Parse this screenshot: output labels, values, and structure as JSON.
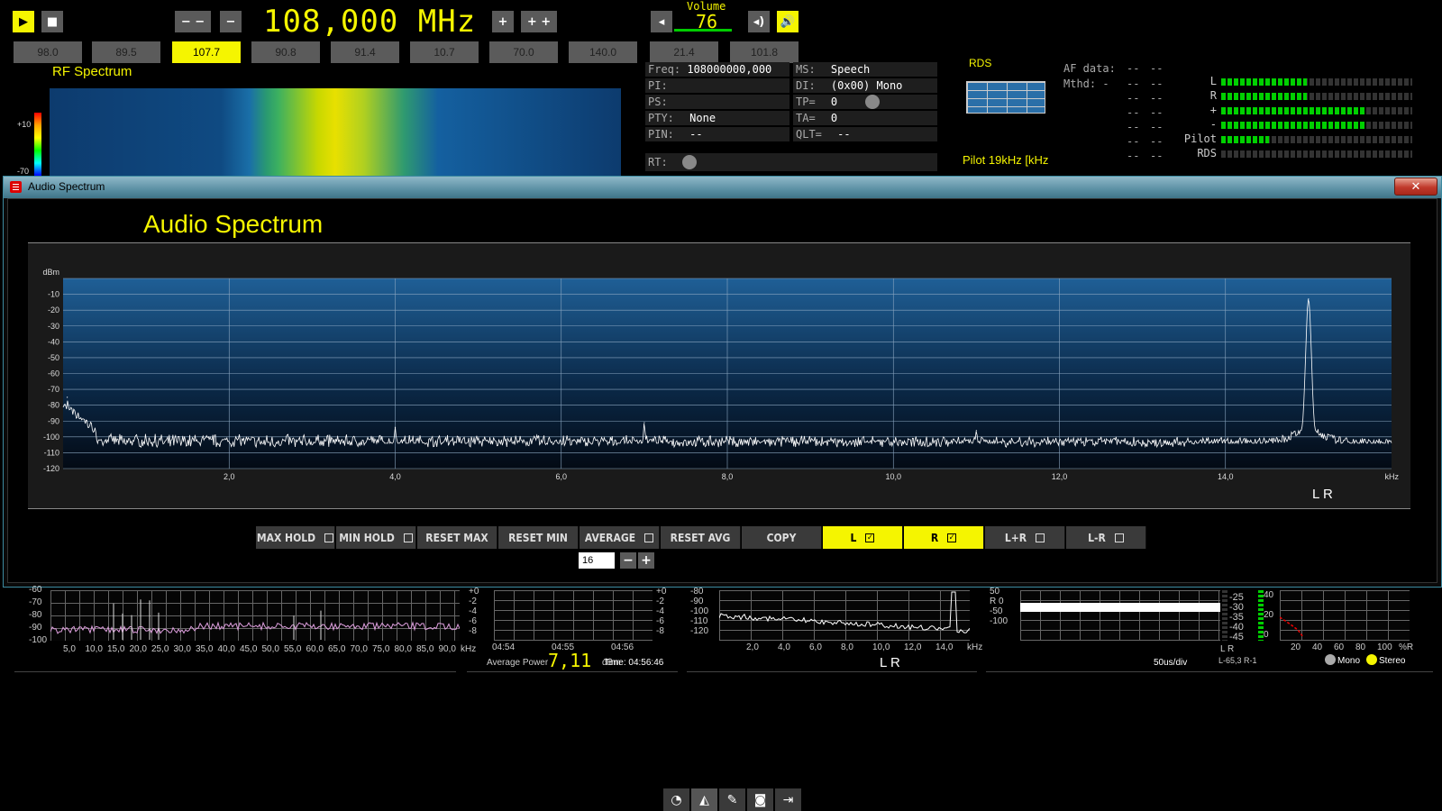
{
  "toolbar": {
    "play_icon": "play-icon",
    "stop_icon": "stop-icon",
    "tune_down_fast": "− −",
    "tune_down": "−",
    "frequency": "108,000 MHz",
    "tune_up": "+",
    "tune_up_fast": "+ +",
    "volume_label": "Volume",
    "volume_value": "76",
    "speaker_icon": "speaker-icon"
  },
  "presets": [
    "98.0",
    "89.5",
    "107.7",
    "90.8",
    "91.4",
    "10.7",
    "70.0",
    "140.0",
    "21.4",
    "101.8"
  ],
  "active_preset": "107.7",
  "rf": {
    "title": "RF Spectrum",
    "scale_top": "+10",
    "scale_bottom": "-70"
  },
  "rds": {
    "freq_label": "Freq:",
    "freq_value": "108000000,000 Hz",
    "ms_label": "MS:",
    "ms_value": "Speech",
    "pi_label": "PI:",
    "di_label": "DI:",
    "di_value": "(0x00) Mono",
    "ps_label": "PS:",
    "tp_label": "TP=",
    "tp_value": "0",
    "pty_label": "PTY:",
    "pty_value": "None",
    "ta_label": "TA=",
    "ta_value": "0",
    "pin_label": "PIN:",
    "pin_value": "--",
    "qlt_label": "QLT=",
    "qlt_value": "--",
    "rt_label": "RT:",
    "grid_label": "RDS",
    "pilot_label": "Pilot 19kHz  [kHz"
  },
  "af": {
    "af_label": "AF data:",
    "mthd_label": "Mthd: -",
    "dash": "--"
  },
  "meters": {
    "labels": [
      "L",
      "R",
      "+",
      "-",
      "Pilot",
      "RDS"
    ],
    "levels": [
      0.45,
      0.45,
      0.75,
      0.75,
      0.25,
      0.0
    ]
  },
  "dialog": {
    "title": "Audio Spectrum",
    "close": "✕",
    "heading": "Audio Spectrum",
    "channel_label": "L R",
    "controls": [
      {
        "label": "MAX HOLD",
        "checked": false,
        "on": false
      },
      {
        "label": "MIN HOLD",
        "checked": false,
        "on": false
      },
      {
        "label": "RESET MAX",
        "checked": null,
        "on": false
      },
      {
        "label": "RESET MIN",
        "checked": null,
        "on": false
      },
      {
        "label": "AVERAGE",
        "checked": false,
        "on": false
      },
      {
        "label": "RESET AVG",
        "checked": null,
        "on": false
      },
      {
        "label": "COPY",
        "checked": null,
        "on": false
      },
      {
        "label": "L",
        "checked": true,
        "on": true
      },
      {
        "label": "R",
        "checked": true,
        "on": true
      },
      {
        "label": "L+R",
        "checked": false,
        "on": false
      },
      {
        "label": "L-R",
        "checked": false,
        "on": false
      }
    ],
    "average_count": "16",
    "minus": "−",
    "plus": "+"
  },
  "chart_data": {
    "type": "line",
    "title": "",
    "ylabel": "dBm",
    "xlabel": "kHz",
    "xlim": [
      0,
      16
    ],
    "ylim": [
      -120,
      0
    ],
    "yticks": [
      -10,
      -20,
      -30,
      -40,
      -50,
      -60,
      -70,
      -80,
      -90,
      -100,
      -110,
      -120
    ],
    "xticks": [
      "2,0",
      "4,0",
      "6,0",
      "8,0",
      "10,0",
      "12,0",
      "14,0"
    ],
    "series": [
      {
        "noise_floor": -104,
        "peaks": [
          {
            "x": 0.05,
            "y": -75
          },
          {
            "x": 4.0,
            "y": -94
          },
          {
            "x": 7.0,
            "y": -91
          },
          {
            "x": 11.0,
            "y": -96
          },
          {
            "x": 15.0,
            "y": -13
          }
        ]
      }
    ]
  },
  "bottom": {
    "p1_ticks_y": [
      "-60",
      "-70",
      "-80",
      "-90",
      "-100"
    ],
    "p1_ticks_x": [
      "5,0",
      "10,0",
      "15,0",
      "20,0",
      "25,0",
      "30,0",
      "35,0",
      "40,0",
      "45,0",
      "50,0",
      "55,0",
      "60,0",
      "65,0",
      "70,0",
      "75,0",
      "80,0",
      "85,0",
      "90,0",
      "kHz"
    ],
    "p2_ticks_left": [
      "+0",
      "-2",
      "-4",
      "-6",
      "-8"
    ],
    "p2_ticks_right": [
      "+0",
      "-2",
      "-4",
      "-6",
      "-8"
    ],
    "p2_times": [
      "04:54",
      "04:55",
      "04:56"
    ],
    "p2_avg_label": "Average Power",
    "p2_avg_value": "7,11",
    "p2_unit": "dBm",
    "p2_time_label": "Time: 04:56:46",
    "p3_ticks_y": [
      "-80",
      "-90",
      "-100",
      "-110",
      "-120"
    ],
    "p3_ticks_x": [
      "2,0",
      "4,0",
      "6,0",
      "8,0",
      "10,0",
      "12,0",
      "14,0",
      "kHz"
    ],
    "p3_channel": "L R",
    "p4_ticks": [
      "50",
      "R 0",
      "-50",
      "-100"
    ],
    "p4_div": "50us/div",
    "p5_ticks": [
      "-25",
      "-30",
      "-35",
      "-40",
      "-45"
    ],
    "p5_lr": "L     R",
    "p5_readout": "L-65,3  R-1",
    "p6_ticks_y": [
      "40",
      "20",
      "0"
    ],
    "p6_ticks_x": [
      "20",
      "40",
      "60",
      "80",
      "100",
      "%R"
    ],
    "p6_mono": "Mono",
    "p6_stereo": "Stereo"
  },
  "dock": [
    "dashboard-icon",
    "spectrum-icon",
    "wrench-icon",
    "camera-icon",
    "exit-icon"
  ]
}
